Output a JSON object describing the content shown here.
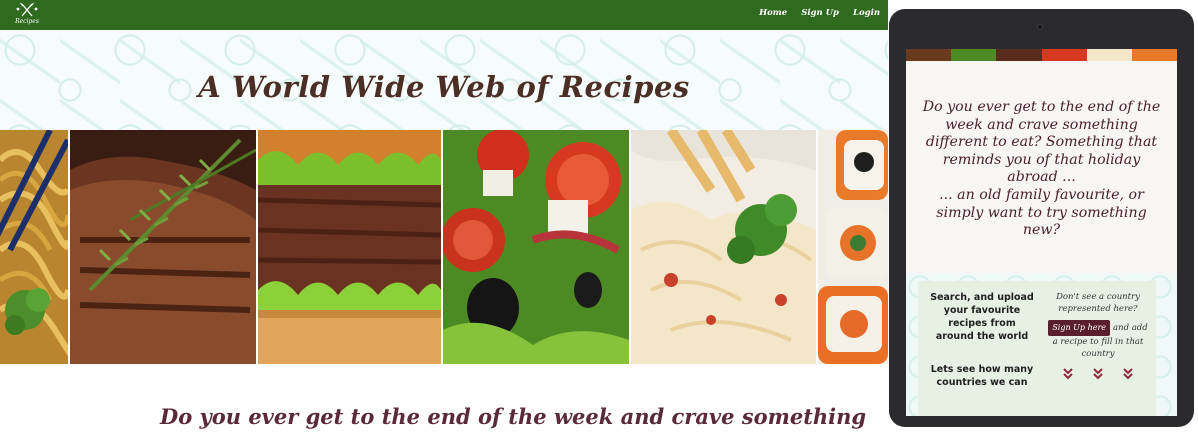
{
  "site": {
    "logo_text": "Recipes",
    "nav": [
      {
        "label": "Home"
      },
      {
        "label": "Sign Up"
      },
      {
        "label": "Login"
      }
    ]
  },
  "hero": {
    "title": "A World Wide Web of Recipes"
  },
  "intro_excerpt": "Do you ever get to the end of the week and crave something",
  "tablet": {
    "intro_lines": [
      "Do you ever get to the end of the",
      "week and crave something",
      "different to eat? Something that",
      "reminds you of that holiday",
      "abroad ...",
      "... an old family favourite, or",
      "simply want to try something",
      "new?"
    ],
    "card": {
      "left_lines": [
        "Search, and upload",
        "your favourite",
        "recipes from",
        "around the world"
      ],
      "left_lines_2": [
        "Lets see how many",
        "countries we can"
      ],
      "right_lines": [
        "Don't see a country",
        "represented here?"
      ],
      "signup_label": "Sign Up here",
      "signup_after": "and add",
      "right_lines_2": [
        "a recipe to fill in that",
        "country"
      ]
    }
  },
  "food_images": [
    {
      "icon": "noodles-image"
    },
    {
      "icon": "steak-rosemary-image"
    },
    {
      "icon": "burger-image"
    },
    {
      "icon": "greek-salad-image"
    },
    {
      "icon": "pasta-image"
    },
    {
      "icon": "sushi-image"
    }
  ],
  "colors": {
    "nav_green": "#2f6a1f",
    "title_brown": "#4b2e26",
    "text_plum": "#5a2a3a",
    "button_maroon": "#5a1f2f",
    "tablet_body": "#2b2b2d",
    "chevron_red": "#8e2a3a"
  }
}
